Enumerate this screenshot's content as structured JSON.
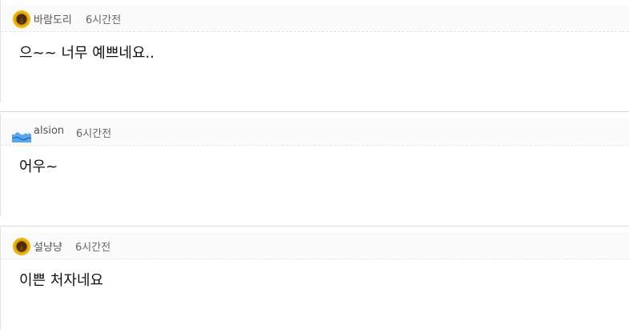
{
  "comments": [
    {
      "author": "바람도리",
      "time": "6시간전",
      "text": "으~~ 너무 예쁘네요..",
      "avatar_icon": "gold-coin-icon"
    },
    {
      "author": "alsion",
      "time": "6시간전",
      "text": "어우~",
      "avatar_icon": "wave-icon"
    },
    {
      "author": "설냥냥",
      "time": "6시간전",
      "text": "이쁜 처자네요",
      "avatar_icon": "gold-coin-icon"
    }
  ],
  "colors": {
    "header_bg": "#fbfbfb",
    "author_text": "#555555",
    "time_text": "#666666",
    "body_text": "#111111",
    "separator": "#d9d9d9"
  }
}
